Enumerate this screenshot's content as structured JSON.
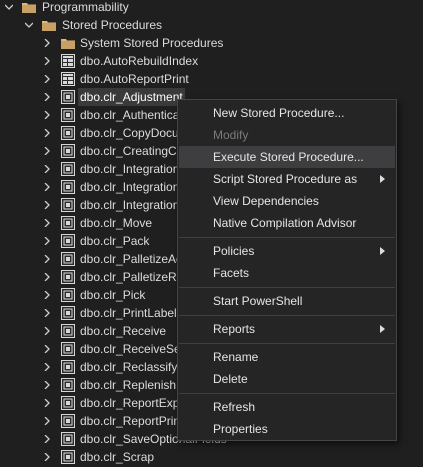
{
  "tree": {
    "programmability": "Programmability",
    "stored_procedures": "Stored Procedures",
    "system_stored_procedures": "System Stored Procedures",
    "items": [
      "dbo.AutoRebuildIndex",
      "dbo.AutoReportPrint",
      "dbo.clr_Adjustment",
      "dbo.clr_Authentica",
      "dbo.clr_CopyDocu",
      "dbo.clr_CreatingCa",
      "dbo.clr_Integration",
      "dbo.clr_Integration",
      "dbo.clr_Integration",
      "dbo.clr_Move",
      "dbo.clr_Pack",
      "dbo.clr_PalletizeAc",
      "dbo.clr_PalletizeRe",
      "dbo.clr_Pick",
      "dbo.clr_PrintLabel",
      "dbo.clr_Receive",
      "dbo.clr_ReceiveSer",
      "dbo.clr_Reclassify",
      "dbo.clr_Replenish",
      "dbo.clr_ReportExp",
      "dbo.clr_ReportPrin",
      "dbo.clr_SaveOptionalFields",
      "dbo.clr_Scrap"
    ]
  },
  "context_menu": {
    "new_stored_procedure": "New Stored Procedure...",
    "modify": "Modify",
    "execute_stored_procedure": "Execute Stored Procedure...",
    "script_stored_procedure_as": "Script Stored Procedure as",
    "view_dependencies": "View Dependencies",
    "native_compilation_advisor": "Native Compilation Advisor",
    "policies": "Policies",
    "facets": "Facets",
    "start_powershell": "Start PowerShell",
    "reports": "Reports",
    "rename": "Rename",
    "delete": "Delete",
    "refresh": "Refresh",
    "properties": "Properties"
  },
  "colors": {
    "background": "#1f1f1f",
    "folder": "#dcb67a",
    "selection": "#3a3a3a",
    "menu_background": "#252526",
    "menu_highlight": "#3e3e40"
  }
}
